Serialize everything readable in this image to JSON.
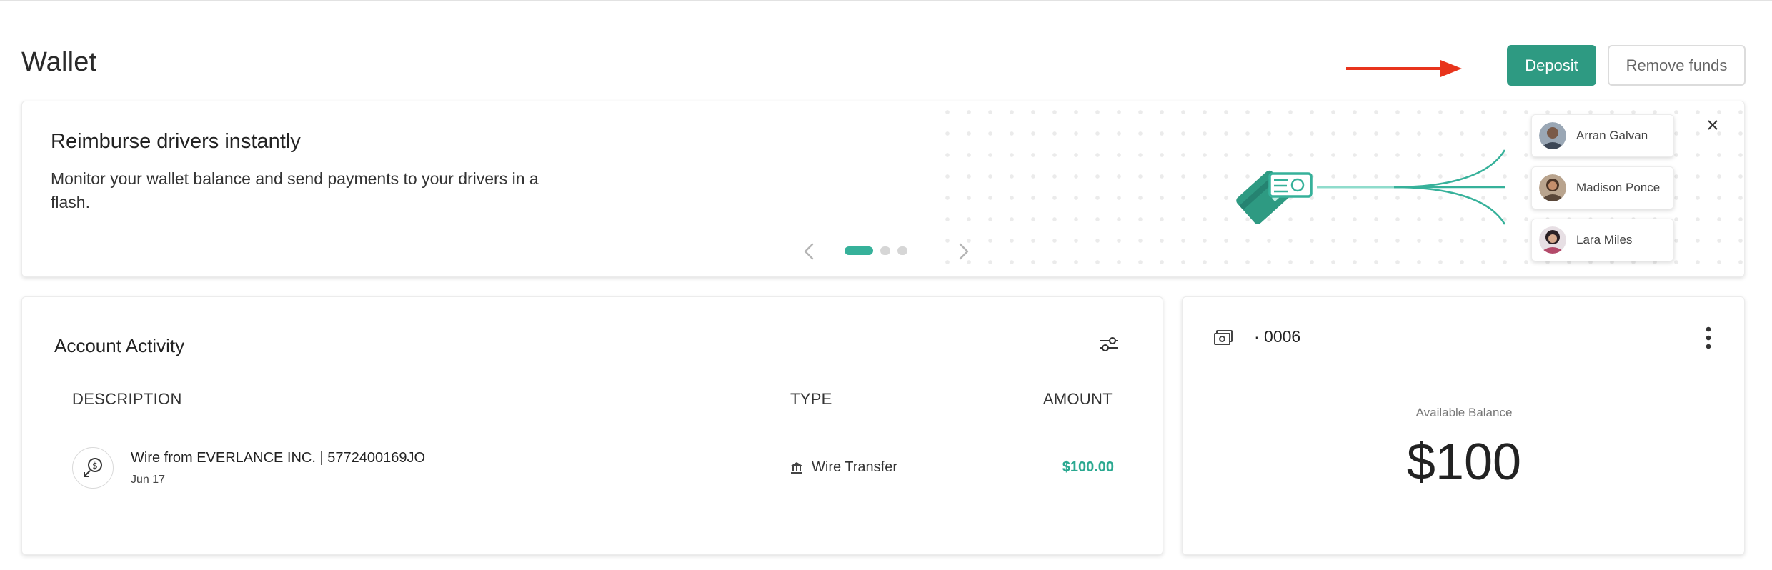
{
  "page": {
    "title": "Wallet"
  },
  "actions": {
    "deposit_label": "Deposit",
    "remove_funds_label": "Remove funds"
  },
  "banner": {
    "title": "Reimburse drivers instantly",
    "text": "Monitor your wallet balance and send payments to your drivers in a flash.",
    "carousel": {
      "total_slides": 3,
      "active_slide": 1
    },
    "drivers": [
      {
        "name": "Arran Galvan"
      },
      {
        "name": "Madison Ponce"
      },
      {
        "name": "Lara Miles"
      }
    ]
  },
  "activity": {
    "title": "Account Activity",
    "columns": {
      "description": "DESCRIPTION",
      "type": "TYPE",
      "amount": "AMOUNT"
    },
    "rows": [
      {
        "description": "Wire from EVERLANCE INC. | 5772400169JO",
        "date": "Jun 17",
        "type": "Wire Transfer",
        "amount": "$100.00"
      }
    ]
  },
  "account": {
    "number": "· 0006",
    "balance_label": "Available Balance",
    "balance": "$100"
  },
  "colors": {
    "brand": "#2e9a82",
    "accent": "#36b19a",
    "amount_positive": "#2aa890",
    "annotation_arrow": "#e8341c"
  },
  "icons": [
    "annotation-arrow",
    "chevron-left-icon",
    "chevron-right-icon",
    "close-icon",
    "filter-icon",
    "deposit-icon",
    "bank-icon",
    "cash-icon",
    "kebab-menu-icon",
    "card-payment-illustration"
  ]
}
